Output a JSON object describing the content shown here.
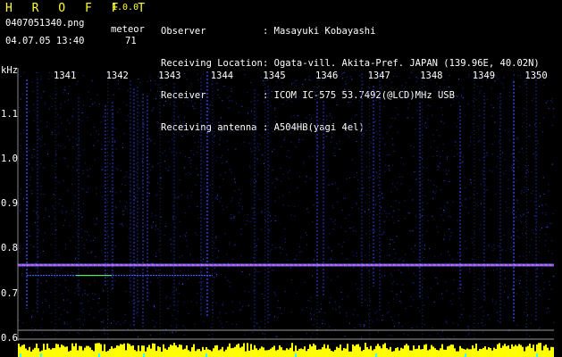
{
  "app": {
    "title": "H R O F F T",
    "version": "1.0.0"
  },
  "file": {
    "name": "0407051340.png",
    "datetime": "04.07.05 13:40"
  },
  "meteor": {
    "label": "meteor",
    "count": "71"
  },
  "station": {
    "observer_label": "Observer",
    "observer_value": ": Masayuki Kobayashi",
    "location_label": "Receiving Location",
    "location_value": ": Ogata-vill. Akita-Pref. JAPAN (139.96E, 40.02N)",
    "receiver_label": "Receiver",
    "receiver_value": ": ICOM IC-575 53.7492(@LCD)MHz USB",
    "antenna_label": "Receiving antenna",
    "antenna_value": ": A504HB(yagi 4el)"
  },
  "spectrogram": {
    "unit": "kHz",
    "minute_labels": [
      "1341",
      "1342",
      "1343",
      "1344",
      "1345",
      "1346",
      "1347",
      "1348",
      "1349",
      "1350"
    ],
    "freq_labels": [
      "1.1",
      "1.0",
      "0.9",
      "0.8",
      "0.7",
      "0.6"
    ],
    "freq_values": [
      1.1,
      1.0,
      0.9,
      0.8,
      0.7,
      0.6
    ],
    "carrier_khz": 0.765,
    "colors": {
      "background": "#000000",
      "signal_low": "#2233ff",
      "signal_high": "#ff33ff",
      "level_bars": "#ffff00",
      "text": "#ffffff",
      "title": "#ffff33"
    }
  }
}
